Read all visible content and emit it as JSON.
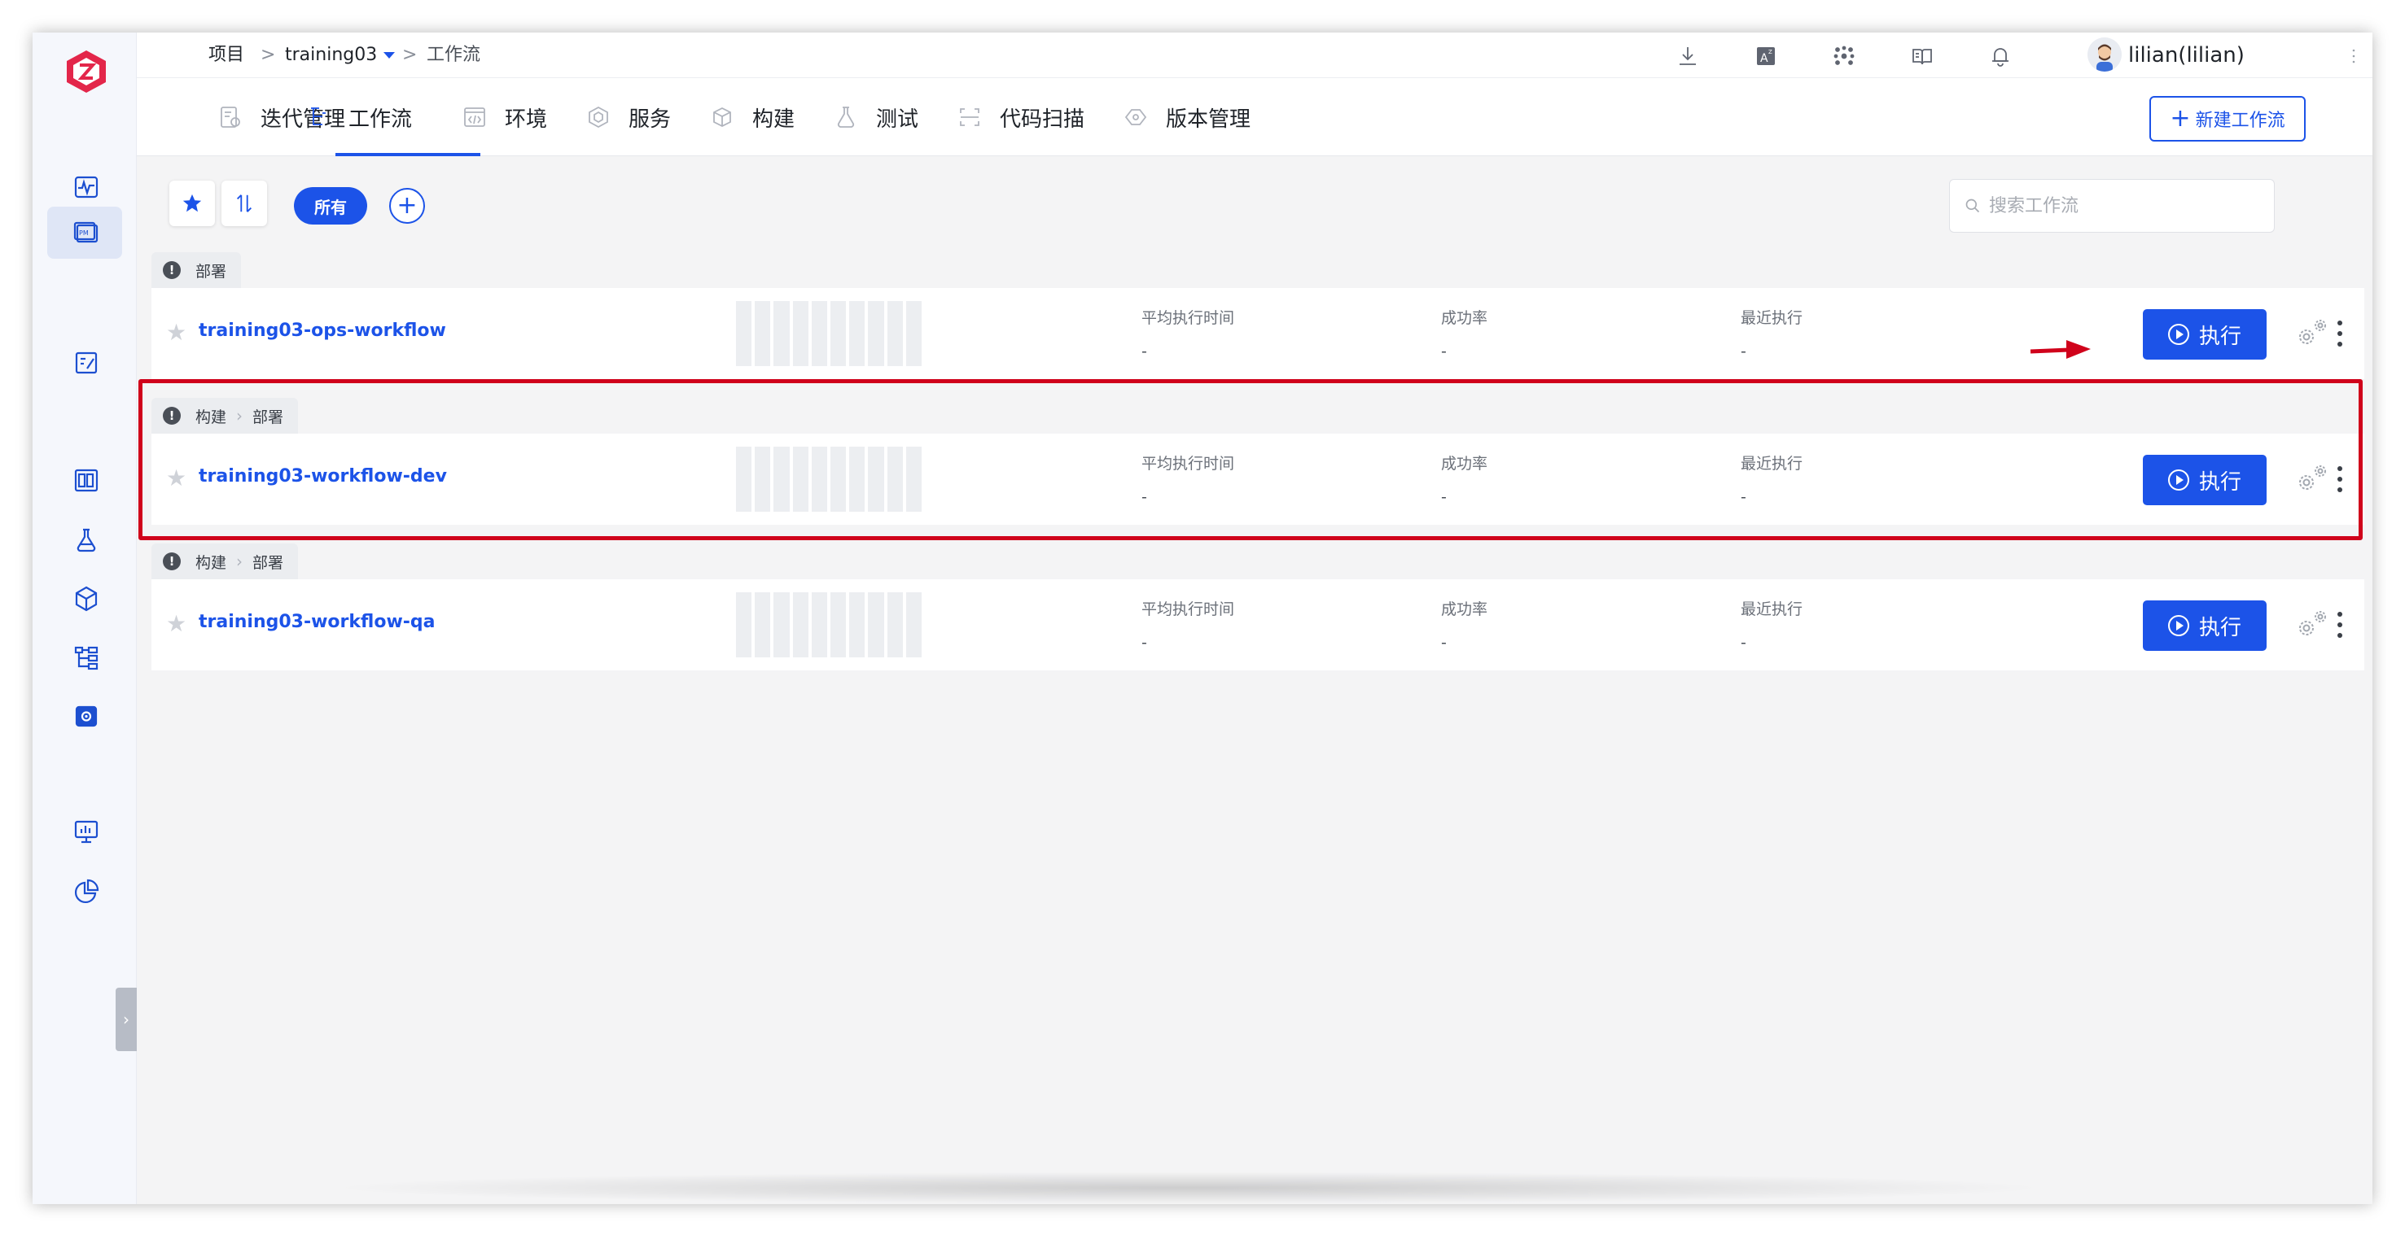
{
  "breadcrumb": {
    "root": "项目",
    "sep1": ">",
    "project": "training03",
    "sep2": ">",
    "current": "工作流"
  },
  "user": {
    "name": "lilian(lilian)"
  },
  "tabs": [
    {
      "label": "迭代管理",
      "icon": "iteration-icon"
    },
    {
      "label": "工作流",
      "icon": "workflow-icon"
    },
    {
      "label": "环境",
      "icon": "environment-icon"
    },
    {
      "label": "服务",
      "icon": "service-icon"
    },
    {
      "label": "构建",
      "icon": "build-icon"
    },
    {
      "label": "测试",
      "icon": "test-icon"
    },
    {
      "label": "代码扫描",
      "icon": "scan-icon"
    },
    {
      "label": "版本管理",
      "icon": "version-icon"
    }
  ],
  "toolbar": {
    "new_workflow": "新建工作流",
    "filter_all": "所有",
    "search_placeholder": "搜索工作流"
  },
  "workflows": [
    {
      "tags": [
        "部署"
      ],
      "name": "training03-ops-workflow",
      "stats": [
        {
          "label": "平均执行时间",
          "value": "-"
        },
        {
          "label": "成功率",
          "value": "-"
        },
        {
          "label": "最近执行",
          "value": "-"
        }
      ],
      "run_label": "执行"
    },
    {
      "tags": [
        "构建",
        "部署"
      ],
      "name": "training03-workflow-dev",
      "stats": [
        {
          "label": "平均执行时间",
          "value": "-"
        },
        {
          "label": "成功率",
          "value": "-"
        },
        {
          "label": "最近执行",
          "value": "-"
        }
      ],
      "run_label": "执行"
    },
    {
      "tags": [
        "构建",
        "部署"
      ],
      "name": "training03-workflow-qa",
      "stats": [
        {
          "label": "平均执行时间",
          "value": "-"
        },
        {
          "label": "成功率",
          "value": "-"
        },
        {
          "label": "最近执行",
          "value": "-"
        }
      ],
      "run_label": "执行"
    }
  ],
  "colors": {
    "accent": "#1c53e8",
    "highlight": "#d0021b"
  }
}
